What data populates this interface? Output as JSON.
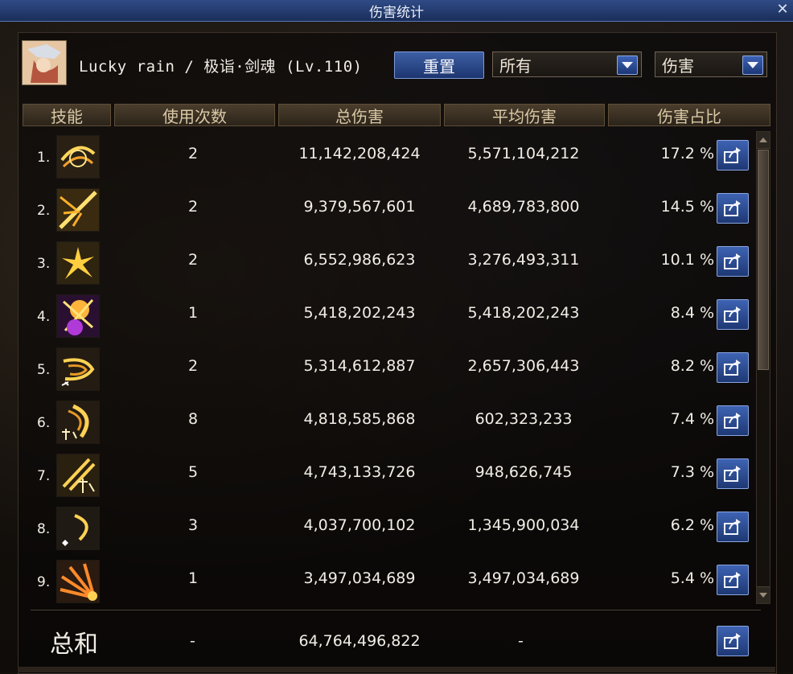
{
  "window": {
    "title": "伤害统计",
    "close_glyph": "✕"
  },
  "player": {
    "name": "Lucky rain / 极诣·剑魂 (Lv.110)"
  },
  "controls": {
    "reset_label": "重置",
    "filter_select": "所有",
    "metric_select": "伤害"
  },
  "table": {
    "headers": [
      "技能",
      "使用次数",
      "总伤害",
      "平均伤害",
      "伤害占比"
    ],
    "rows": [
      {
        "rank": "1.",
        "uses": "2",
        "total": "11,142,208,424",
        "avg": "5,571,104,212",
        "pct": "17.2 %"
      },
      {
        "rank": "2.",
        "uses": "2",
        "total": "9,379,567,601",
        "avg": "4,689,783,800",
        "pct": "14.5 %"
      },
      {
        "rank": "3.",
        "uses": "2",
        "total": "6,552,986,623",
        "avg": "3,276,493,311",
        "pct": "10.1 %"
      },
      {
        "rank": "4.",
        "uses": "1",
        "total": "5,418,202,243",
        "avg": "5,418,202,243",
        "pct": "8.4 %"
      },
      {
        "rank": "5.",
        "uses": "2",
        "total": "5,314,612,887",
        "avg": "2,657,306,443",
        "pct": "8.2 %"
      },
      {
        "rank": "6.",
        "uses": "8",
        "total": "4,818,585,868",
        "avg": "602,323,233",
        "pct": "7.4 %"
      },
      {
        "rank": "7.",
        "uses": "5",
        "total": "4,743,133,726",
        "avg": "948,626,745",
        "pct": "7.3 %"
      },
      {
        "rank": "8.",
        "uses": "3",
        "total": "4,037,700,102",
        "avg": "1,345,900,034",
        "pct": "6.2 %"
      },
      {
        "rank": "9.",
        "uses": "1",
        "total": "3,497,034,689",
        "avg": "3,497,034,689",
        "pct": "5.4 %"
      }
    ]
  },
  "summary": {
    "label": "总和",
    "uses": "-",
    "total": "64,764,496,822",
    "avg": "-"
  },
  "icons": {
    "skill_icons": [
      "slash-swirl-icon",
      "sword-burst-icon",
      "star-burst-icon",
      "purple-explosion-icon",
      "wave-slash-icon",
      "flow-crescent-icon",
      "flow-slash-icon",
      "crescent-spark-icon",
      "fire-fan-icon"
    ],
    "share": "share-icon"
  },
  "colors": {
    "accent_blue": "#2f55a6",
    "header_brown": "#3d3224",
    "text": "#f2eee6"
  }
}
